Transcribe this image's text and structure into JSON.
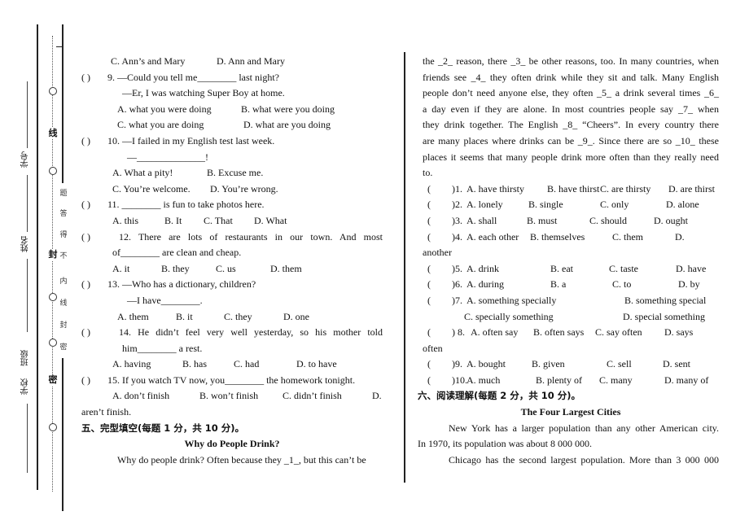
{
  "binding_margin": {
    "info_labels": [
      "学号",
      "姓名",
      "班级",
      "学校"
    ],
    "seal_chars": [
      "线",
      "封",
      "密"
    ],
    "notice_chars": [
      "题",
      "答",
      "得",
      "不",
      "内",
      "线",
      "封",
      "密"
    ]
  },
  "left_column": {
    "q8_options_cd": {
      "c": "C. Ann’s and Mary",
      "d": "D. Ann and Mary"
    },
    "q9": {
      "paren": "(        )",
      "stem": "9. —Could you tell me________ last night?",
      "reply": "—Er, I was watching Super Boy at home.",
      "a": "A. what you were doing",
      "b": "B. what were you doing",
      "c": "C. what you are doing",
      "d": "D. what are you doing"
    },
    "q10": {
      "paren": "(        )",
      "stem": "10. —I failed in my English test last week.",
      "reply": "—______________!",
      "a": "A. What a pity!",
      "b": "B. Excuse me.",
      "c": "C. You’re welcome.",
      "d": "D. You’re wrong."
    },
    "q11": {
      "paren": "(        )",
      "stem": "11. ________ is fun to take photos here.",
      "a": "A. this",
      "b": "B. It",
      "c": "C. That",
      "d": "D. What"
    },
    "q12": {
      "paren": "(          )",
      "stem": "12. There are lots of restaurants in our town. And most",
      "cont": "of________ are clean and cheap.",
      "a": "A. it",
      "b": "B. they",
      "c": "C. us",
      "d": "D. them"
    },
    "q13": {
      "paren": "(        )",
      "stem": "13. —Who has a dictionary, children?",
      "reply": "—I have________.",
      "a": "A. them",
      "b": "B. it",
      "c": "C. they",
      "d": "D. one"
    },
    "q14": {
      "paren": "(          )",
      "stem": "14. He didn’t feel very well yesterday, so his mother told",
      "cont": "him________ a rest.",
      "a": "A. having",
      "b": "B. has",
      "c": "C. had",
      "d": "D. to have"
    },
    "q15": {
      "paren": "(        )",
      "stem": "15. If you watch TV now, you________ the homework tonight.",
      "a": "A. don’t finish",
      "b": "B. won’t finish",
      "c": "C. didn’t finish",
      "d": "D.",
      "d_cont": "aren’t finish."
    },
    "section5_heading": "五、完型填空(每题 1 分，共 10 分)。",
    "cloze_title": "Why do People Drink?",
    "cloze_first_line": "Why do people drink? Often because they _1_, but this can’t be"
  },
  "right_column": {
    "cloze_passage_lines": [
      "the _2_ reason, there _3_ be other reasons, too. In many countries, when",
      "friends see _4_ they often drink while they sit and talk. Many English",
      "people don’t need anyone else, they often _5_ a drink several times _6_",
      "a day even if they are alone. In most countries people say _7_ when",
      "they drink together. The English _8_ “Cheers”. In every country there",
      "are many places where drinks can be _9_. Since there are so _10_ these",
      "places it seems that many people drink more often than they really need",
      "to."
    ],
    "cloze_questions": [
      {
        "paren": "(",
        "num": ")1.",
        "a": "A. have thirsty",
        "b": "B. have thirst",
        "c": "C. are thirsty",
        "d": "D. are thirst"
      },
      {
        "paren": "(",
        "num": ")2.",
        "a": "A. lonely",
        "b": "B. single",
        "c": "C. only",
        "d": "D. alone"
      },
      {
        "paren": "(",
        "num": ")3.",
        "a": "A. shall",
        "b": "B. must",
        "c": "C. should",
        "d": "D. ought"
      },
      {
        "paren": "(",
        "num": ")4.",
        "a": "A. each other",
        "b": "B. themselves",
        "c": "C. them",
        "d": "D.",
        "d_cont": "another"
      },
      {
        "paren": "(",
        "num": ")5.",
        "a": "A. drink",
        "b": "B. eat",
        "c": "C. taste",
        "d": "D. have"
      },
      {
        "paren": "(",
        "num": ")6.",
        "a": "A. during",
        "b": "B. a",
        "c": "C. to",
        "d": "D. by"
      },
      {
        "paren": "(",
        "num": ")7.",
        "a": "A. something specially",
        "b": "B. something special",
        "c": "C. specially something",
        "d": "D. special something"
      },
      {
        "paren": "(",
        "num": ") 8.",
        "a": "A. often say",
        "b": "B. often says",
        "c": "C. say often",
        "d": "D. says",
        "d_cont": "often"
      },
      {
        "paren": "(",
        "num": ")9.",
        "a": "A. bought",
        "b": "B. given",
        "c": "C. sell",
        "d": "D. sent"
      },
      {
        "paren": "(",
        "num": ")10.",
        "a": "A. much",
        "b": "B. plenty of",
        "c": "C. many",
        "d": "D. many of"
      }
    ],
    "section6_heading": "六、阅读理解(每题 2 分，共 10 分)。",
    "reading_title": "The Four Largest Cities",
    "reading_p1_line1": "New York has a larger population than any other American city.",
    "reading_p1_line2": "In 1970, its population was about 8 000 000.",
    "reading_p2_line1": "Chicago has the second largest population. More than 3 000 000"
  }
}
